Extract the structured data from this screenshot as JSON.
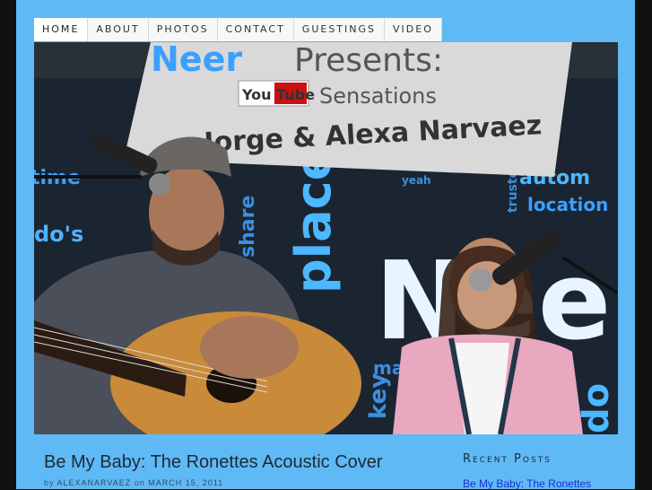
{
  "nav": {
    "items": [
      {
        "label": "HOME",
        "active": true
      },
      {
        "label": "ABOUT",
        "active": false
      },
      {
        "label": "PHOTOS",
        "active": false
      },
      {
        "label": "CONTACT",
        "active": false
      },
      {
        "label": "GUESTINGS",
        "active": false
      },
      {
        "label": "VIDEO",
        "active": false
      }
    ]
  },
  "hero": {
    "banner_line1_brand": "Neer",
    "banner_line1_rest": "Presents:",
    "banner_youtube": "You Tube",
    "banner_sensations": "Sensations",
    "banner_names": "Jorge & Alexa Narvaez",
    "backdrop_words": [
      "time",
      "do's",
      "place",
      "share",
      "yeah",
      "autom",
      "location",
      "trusted",
      "Nee",
      "key",
      "magic",
      "do"
    ]
  },
  "post": {
    "title": "Be My Baby: The Ronettes Acoustic Cover",
    "by_label": "by",
    "author": "ALEXANARVAEZ",
    "on_label": "on",
    "date": "MARCH 15, 2011"
  },
  "sidebar": {
    "recent_posts_title": "Recent Posts",
    "recent_posts": [
      "Be My Baby: The Ronettes"
    ]
  },
  "colors": {
    "page_background": "#5fb9f5",
    "outer_background": "#111111",
    "link": "#1a2fcf",
    "title_text": "#1c2a36"
  }
}
